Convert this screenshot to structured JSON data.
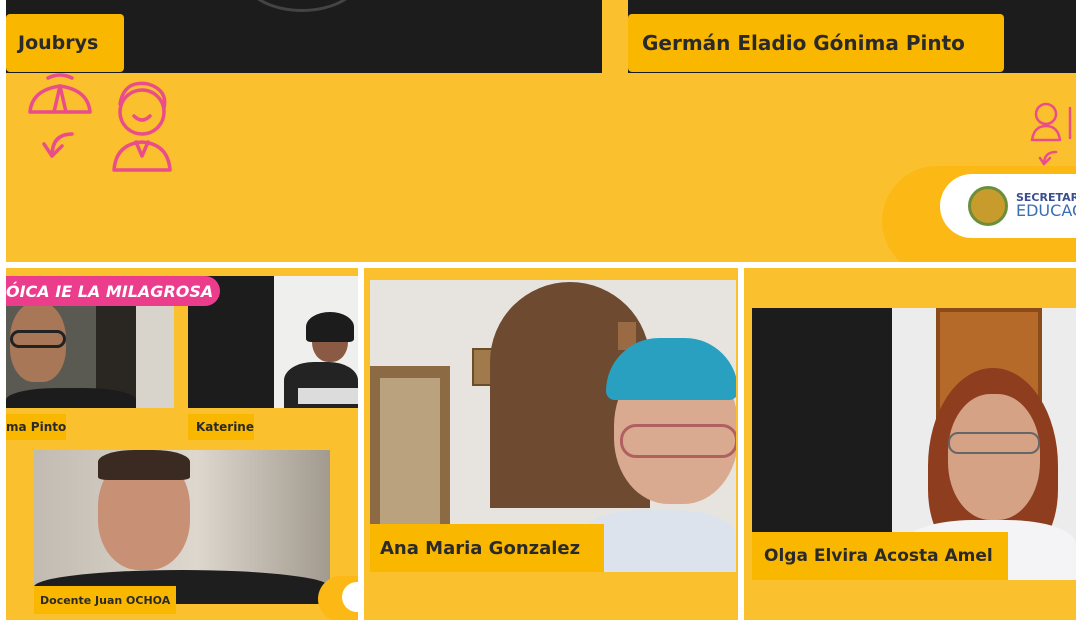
{
  "participants": {
    "top_left_name": "Joubrys",
    "top_right_name": "Germán Eladio Gónima Pinto",
    "bottom_center_name": "Ana Maria Gonzalez",
    "bottom_right_name": "Olga Elvira Acosta Amel",
    "shared_left_name": "ma Pinto",
    "shared_right_name": "Katerine",
    "shared_bottom_name": "Docente Juan OCHOA"
  },
  "banner": {
    "text": "ÓICA IE LA MILAGROSA"
  },
  "logo": {
    "line1": "SECRETARÍ",
    "line2": "EDUCAC"
  },
  "colors": {
    "panel_yellow": "#fbc02d",
    "tag_yellow": "#f9b700",
    "banner_pink": "#ec3c8c",
    "icon_pink": "#ea4e8a"
  }
}
